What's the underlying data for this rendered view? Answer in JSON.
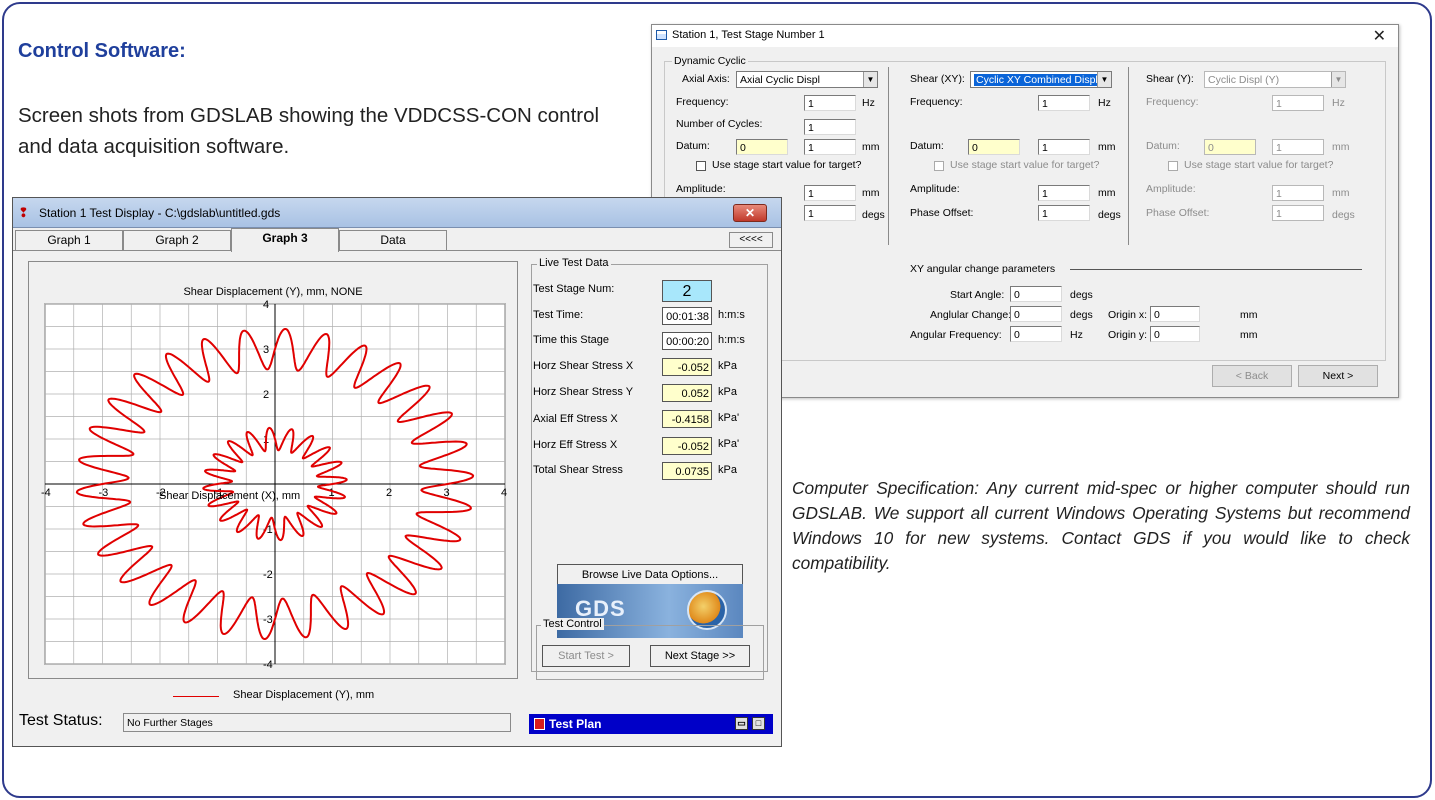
{
  "heading": "Control Software:",
  "description": "Screen shots from GDSLAB showing the VDDCSS-CON control and data acquisition software.",
  "spec_text": "Computer Specification: Any current mid-spec or higher computer should run GDSLAB. We support all current Windows Operating Systems but recommend Windows 10 for new systems. Contact GDS if you would like to check compatibility.",
  "colors": {
    "accent_blue": "#1f3f9c",
    "border_navy": "#2e3a8c",
    "plot_red": "#e00000",
    "test_plan_blue": "#0000c8",
    "live_highlight": "#a8e7fb",
    "field_yellow": "#ffffcc"
  },
  "dialog": {
    "title": "Station 1, Test Stage Number 1",
    "group_label": "Dynamic Cyclic",
    "col1": {
      "axis_label": "Axial Axis:",
      "axis_value": "Axial Cyclic Displ",
      "frequency_label": "Frequency:",
      "frequency": "1",
      "frequency_unit": "Hz",
      "cycles_label": "Number of Cycles:",
      "cycles": "1",
      "datum_label": "Datum:",
      "datum_a": "0",
      "datum_b": "1",
      "datum_unit": "mm",
      "use_start": "Use stage start value for target?",
      "amplitude_label": "Amplitude:",
      "amplitude": "1",
      "amplitude_unit": "mm",
      "phase": "1",
      "phase_unit": "degs"
    },
    "col2": {
      "axis_label": "Shear (XY):",
      "axis_value": "Cyclic XY Combined Displ",
      "frequency_label": "Frequency:",
      "frequency": "1",
      "frequency_unit": "Hz",
      "datum_label": "Datum:",
      "datum_a": "0",
      "datum_b": "1",
      "datum_unit": "mm",
      "use_start": "Use stage start value for target?",
      "amplitude_label": "Amplitude:",
      "amplitude": "1",
      "amplitude_unit": "mm",
      "phase_label": "Phase Offset:",
      "phase": "1",
      "phase_unit": "degs"
    },
    "col3": {
      "axis_label": "Shear (Y):",
      "axis_value": "Cyclic Displ (Y)",
      "frequency_label": "Frequency:",
      "frequency": "1",
      "frequency_unit": "Hz",
      "datum_label": "Datum:",
      "datum_a": "0",
      "datum_b": "1",
      "datum_unit": "mm",
      "use_start": "Use stage start value for target?",
      "amplitude_label": "Amplitude:",
      "amplitude": "1",
      "amplitude_unit": "mm",
      "phase_label": "Phase Offset:",
      "phase": "1",
      "phase_unit": "degs"
    },
    "xy": {
      "section_label": "XY angular change parameters",
      "start_angle_label": "Start Angle:",
      "start_angle": "0",
      "start_angle_unit": "degs",
      "angular_change_label": "Anglular Change:",
      "angular_change": "0",
      "angular_change_unit": "degs",
      "angular_freq_label": "Angular Frequency:",
      "angular_freq": "0",
      "angular_freq_unit": "Hz",
      "origin_x_label": "Origin x:",
      "origin_x": "0",
      "origin_x_unit": "mm",
      "origin_y_label": "Origin y:",
      "origin_y": "0",
      "origin_y_unit": "mm"
    },
    "back_btn": "< Back",
    "next_btn": "Next >"
  },
  "window": {
    "title": "Station 1 Test Display - C:\\gdslab\\untitled.gds",
    "close_glyph": "✕",
    "tabs": [
      "Graph 1",
      "Graph 2",
      "Graph 3",
      "Data"
    ],
    "collapse_btn": "<<<<",
    "graph_title": "Shear Displacement (Y), mm, NONE",
    "x_axis_label": "Shear Displacement (X), mm",
    "legend": "Shear Displacement (Y), mm",
    "x_ticks": [
      "-4",
      "-3",
      "-2",
      "-1",
      "1",
      "2",
      "3",
      "4"
    ],
    "y_ticks": [
      "4",
      "3",
      "2",
      "1",
      "-1",
      "-2",
      "-3",
      "-4"
    ],
    "status_label": "Test Status:",
    "status_value": "No Further Stages",
    "live_title": "Live Test Data",
    "live": [
      {
        "label": "Test Stage Num:",
        "value": "2",
        "unit": ""
      },
      {
        "label": "Test Time:",
        "value": "00:01:38",
        "unit": "h:m:s"
      },
      {
        "label": "Time this Stage",
        "value": "00:00:20",
        "unit": "h:m:s"
      },
      {
        "label": "Horz Shear Stress X",
        "value": "-0.052",
        "unit": "kPa"
      },
      {
        "label": "Horz Shear Stress Y",
        "value": "0.052",
        "unit": "kPa"
      },
      {
        "label": "Axial Eff Stress X",
        "value": "-0.4158",
        "unit": "kPa'"
      },
      {
        "label": "Horz Eff Stress X",
        "value": "-0.052",
        "unit": "kPa'"
      },
      {
        "label": "Total Shear Stress",
        "value": "0.0735",
        "unit": "kPa"
      }
    ],
    "browse_btn": "Browse Live Data Options...",
    "logo_text": "GDS",
    "test_control_title": "Test Control",
    "start_btn": "Start Test >",
    "next_stage_btn": "Next Stage >>",
    "test_plan": "Test Plan"
  },
  "chart_data": {
    "type": "line",
    "title": "Shear Displacement (Y), mm, NONE",
    "xlabel": "Shear Displacement (X), mm",
    "ylabel": "",
    "xlim": [
      -4,
      4
    ],
    "ylim": [
      -4,
      4
    ],
    "grid": true,
    "legend": "bottom",
    "series": [
      {
        "name": "Shear Displacement (Y), mm",
        "shape": "wavy-ring",
        "radius": 3.0,
        "amplitude": 0.45,
        "waves": 30
      },
      {
        "name": "Shear Displacement (Y), mm",
        "shape": "wavy-ring",
        "radius": 1.0,
        "amplitude": 0.25,
        "waves": 20
      }
    ]
  }
}
